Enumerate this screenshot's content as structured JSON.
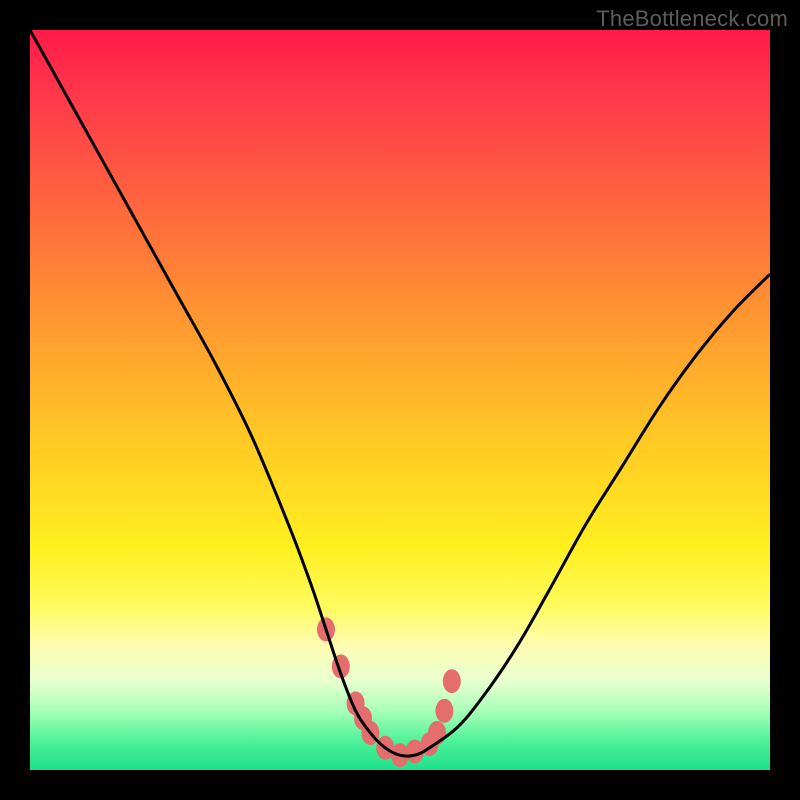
{
  "watermark": "TheBottleneck.com",
  "chart_data": {
    "type": "line",
    "title": "",
    "xlabel": "",
    "ylabel": "",
    "xlim": [
      0,
      100
    ],
    "ylim": [
      0,
      100
    ],
    "series": [
      {
        "name": "bottleneck-curve",
        "x": [
          0,
          5,
          10,
          15,
          20,
          25,
          30,
          35,
          38,
          40,
          42,
          44,
          46,
          48,
          50,
          52,
          54,
          58,
          62,
          66,
          70,
          75,
          80,
          85,
          90,
          95,
          100
        ],
        "y": [
          100,
          91,
          82,
          73,
          64,
          55,
          45,
          33,
          25,
          19,
          13,
          8,
          5,
          3,
          2,
          2,
          3,
          6,
          11,
          17,
          24,
          33,
          41,
          49,
          56,
          62,
          67
        ]
      },
      {
        "name": "highlight-dots",
        "x": [
          40,
          42,
          44,
          45,
          46,
          48,
          50,
          52,
          54,
          55,
          56,
          57
        ],
        "y": [
          19,
          14,
          9,
          7,
          5,
          3,
          2,
          2.5,
          3.5,
          5,
          8,
          12
        ]
      }
    ],
    "colors": {
      "curve": "#000000",
      "dots": "#e46e6e",
      "gradient_top": "#ff1a4a",
      "gradient_mid": "#fff020",
      "gradient_bottom": "#1fe08a",
      "frame": "#000000"
    }
  }
}
